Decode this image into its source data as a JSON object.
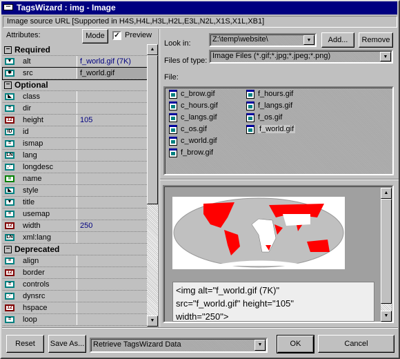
{
  "window": {
    "title": "TagsWizard : img - Image",
    "icon": "app-icon"
  },
  "status": "Image source URL  [Supported in H4S,H4L,H3L,H2L,E3L,N2L,X1S,X1L,XB1]",
  "left": {
    "attributes_label": "Attributes:",
    "mode_button": "Mode",
    "preview_label": "Preview",
    "preview_checked": true,
    "groups": [
      {
        "name": "Required",
        "rows": [
          {
            "name": "alt",
            "value": "f_world.gif (7K)",
            "icon": "text-icon"
          },
          {
            "name": "src",
            "value": "f_world.gif",
            "icon": "image-icon",
            "selected": true
          }
        ]
      },
      {
        "name": "Optional",
        "rows": [
          {
            "name": "class",
            "value": "",
            "icon": "style-icon"
          },
          {
            "name": "dir",
            "value": "",
            "icon": "list-icon"
          },
          {
            "name": "height",
            "value": "105",
            "icon": "number-icon"
          },
          {
            "name": "id",
            "value": "",
            "icon": "id-icon"
          },
          {
            "name": "ismap",
            "value": "",
            "icon": "list-icon"
          },
          {
            "name": "lang",
            "value": "",
            "icon": "lang-icon"
          },
          {
            "name": "longdesc",
            "value": "",
            "icon": "url-icon"
          },
          {
            "name": "name",
            "value": "",
            "icon": "name-icon"
          },
          {
            "name": "style",
            "value": "",
            "icon": "style-icon"
          },
          {
            "name": "title",
            "value": "",
            "icon": "text-icon"
          },
          {
            "name": "usemap",
            "value": "",
            "icon": "list-icon"
          },
          {
            "name": "width",
            "value": "250",
            "icon": "number-icon"
          },
          {
            "name": "xml:lang",
            "value": "",
            "icon": "lang-icon"
          }
        ]
      },
      {
        "name": "Deprecated",
        "rows": [
          {
            "name": "align",
            "value": "",
            "icon": "list-icon"
          },
          {
            "name": "border",
            "value": "",
            "icon": "number-icon"
          },
          {
            "name": "controls",
            "value": "",
            "icon": "list-icon"
          },
          {
            "name": "dynsrc",
            "value": "",
            "icon": "url-icon"
          },
          {
            "name": "hspace",
            "value": "",
            "icon": "number-icon"
          },
          {
            "name": "loop",
            "value": "",
            "icon": "list-icon"
          }
        ]
      }
    ]
  },
  "right": {
    "look_in_label": "Look in:",
    "look_in_value": "Z:\\temp\\website\\",
    "add_button": "Add...",
    "remove_button": "Remove",
    "files_type_label": "Files of type:",
    "files_type_value": "Image Files (*.gif;*.jpg;*.jpeg;*.png)",
    "file_label": "File:",
    "files_col1": [
      "c_brow.gif",
      "c_hours.gif",
      "c_langs.gif",
      "c_os.gif",
      "c_world.gif",
      "f_brow.gif"
    ],
    "files_col2": [
      "f_hours.gif",
      "f_langs.gif",
      "f_os.gif",
      "f_world.gif"
    ],
    "selected_file": "f_world.gif",
    "code_lines": [
      "<img alt=\"f_world.gif (7K)\"",
      "src=\"f_world.gif\" height=\"105\"",
      "width=\"250\">"
    ]
  },
  "bottom": {
    "reset": "Reset",
    "save_as": "Save As...",
    "action_value": "Retrieve TagsWizard Data",
    "ok": "OK",
    "cancel": "Cancel"
  },
  "colors": {
    "title_bar": "#000080",
    "value_text": "#000080",
    "map_highlight": "#ff0000"
  }
}
